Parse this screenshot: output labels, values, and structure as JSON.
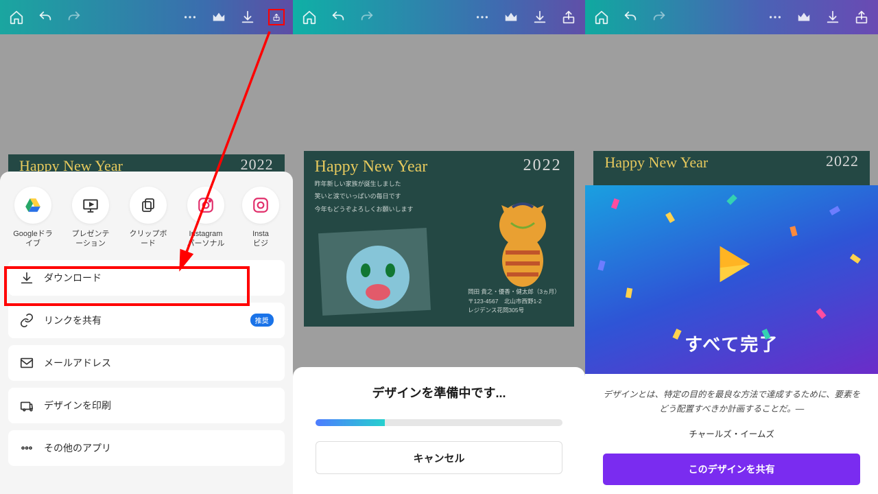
{
  "pane1": {
    "share_apps": [
      {
        "name": "gdrive",
        "label": "Googleドラ\nイブ"
      },
      {
        "name": "present",
        "label": "プレゼンテ\nーション"
      },
      {
        "name": "clipboard",
        "label": "クリップボ\nード"
      },
      {
        "name": "insta",
        "label": "Instagram\nパーソナル"
      },
      {
        "name": "insta2",
        "label": "Insta\nビジ"
      }
    ],
    "options": {
      "download": "ダウンロード",
      "sharelink": "リンクを共有",
      "sharelink_badge": "推奨",
      "email": "メールアドレス",
      "print": "デザインを印刷",
      "other": "その他のアプリ"
    },
    "card_peek": {
      "title": "Happy New Year",
      "year": "2022"
    }
  },
  "pane2": {
    "card": {
      "title": "Happy New Year",
      "year": "2022",
      "msg1": "昨年新しい家族が誕生しました",
      "msg2": "笑いと涙でいっぱいの毎日です",
      "msg3": "今年もどうぞよろしくお願いします",
      "addr1": "岡田 貴之・優香・健太郎（3ヵ月）",
      "addr2": "〒123-4567　北山市西野1-2",
      "addr3": "レジデンス花岡305号"
    },
    "preparing": "デザインを準備中です...",
    "cancel": "キャンセル"
  },
  "pane3": {
    "card_peek": {
      "title": "Happy New Year",
      "year": "2022"
    },
    "done": "すべて完了",
    "quote": "デザインとは、特定の目的を最良な方法で達成するために、要素をどう配置すべきか計画することだ。—",
    "author": "チャールズ・イームズ",
    "share_btn": "このデザインを共有"
  }
}
